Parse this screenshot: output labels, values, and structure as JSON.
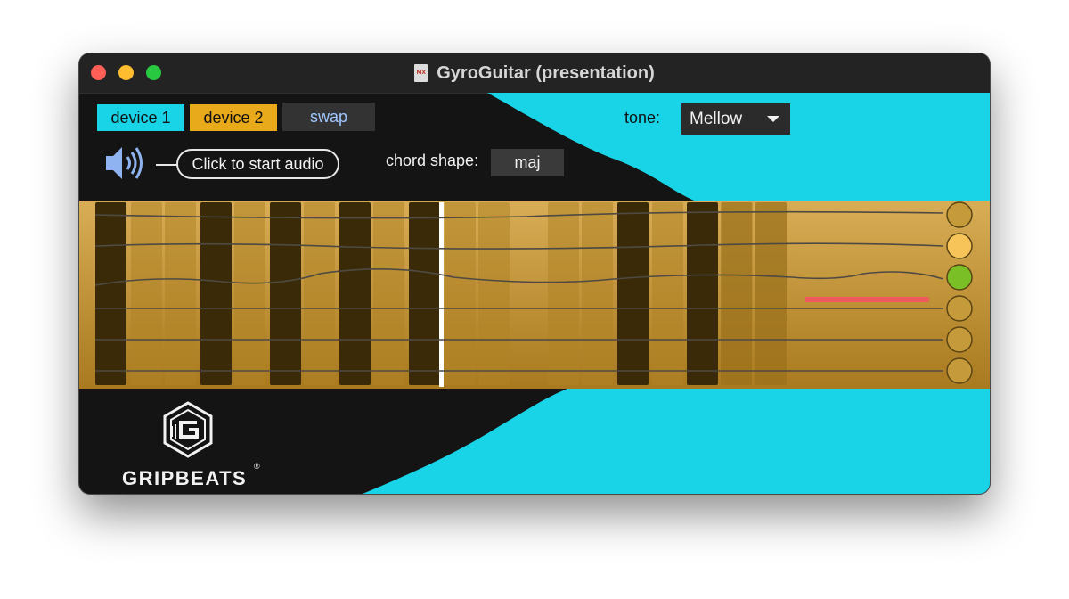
{
  "window": {
    "title": "GyroGuitar (presentation)",
    "doc_icon_text": "MX"
  },
  "devices": {
    "device1_label": "device 1",
    "device2_label": "device 2",
    "swap_label": "swap"
  },
  "audio": {
    "icon": "speaker-icon",
    "callout_text": "Click to start audio"
  },
  "chord": {
    "label": "chord shape:",
    "value": "maj"
  },
  "tone": {
    "label": "tone:",
    "selected": "Mellow",
    "icon": "caret-down-icon"
  },
  "fretboard": {
    "strings": 6,
    "string_indicator_colors": [
      "#c49a3a",
      "#f7c45a",
      "#7bbf26",
      "#c49a3a",
      "#c49a3a",
      "#c49a3a"
    ],
    "active_string_index": 2,
    "bar_colors": {
      "dark": "#3a2a08",
      "light": "#b08426"
    }
  },
  "logo": {
    "name": "GRIPBEATS",
    "mark": "gripbeats-logo-icon",
    "registered": "®"
  },
  "colors": {
    "accent_cyan": "#19d3e6",
    "accent_orange": "#e8a91a",
    "panel_dark": "#141414",
    "wood": "#c3962f",
    "marker": "#f05a5a"
  }
}
